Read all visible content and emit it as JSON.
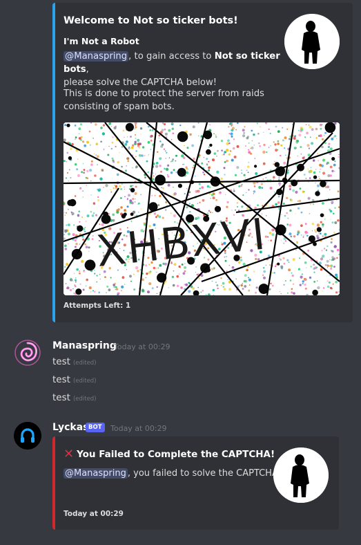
{
  "welcome_embed": {
    "title": "Welcome to Not so ticker bots!",
    "subtitle": "I'm Not a Robot",
    "mention": "@Manaspring",
    "desc_mid": ", to gain access to ",
    "server_name": "Not so ticker bots",
    "desc_end": ",",
    "desc_line2": "please solve the CAPTCHA below!",
    "desc_para2": "This is done to protect the server from raids consisting of spam bots.",
    "captcha_text": "XHBXVI",
    "footer": "Attempts Left: 1",
    "accent_color": "#2ba3ec"
  },
  "message1": {
    "username": "Manaspring",
    "timestamp": "Today at 00:29",
    "lines": [
      {
        "text": "test",
        "edited": "(edited)"
      },
      {
        "text": "test",
        "edited": "(edited)"
      },
      {
        "text": "test",
        "edited": "(edited)"
      }
    ],
    "avatar_icon": "pink-swirl-icon"
  },
  "message2": {
    "username": "Lyckas",
    "bot_tag": "BOT",
    "timestamp": "Today at 00:29",
    "avatar_icon": "blue-headphones-icon",
    "embed": {
      "title": "You Failed to Complete the CAPTCHA!",
      "title_icon": "cross-mark-icon",
      "mention": "@Manaspring",
      "desc": ", you failed to solve the CAPTCHA!",
      "footer": "Today at 00:29",
      "accent_color": "#d0282b"
    }
  }
}
